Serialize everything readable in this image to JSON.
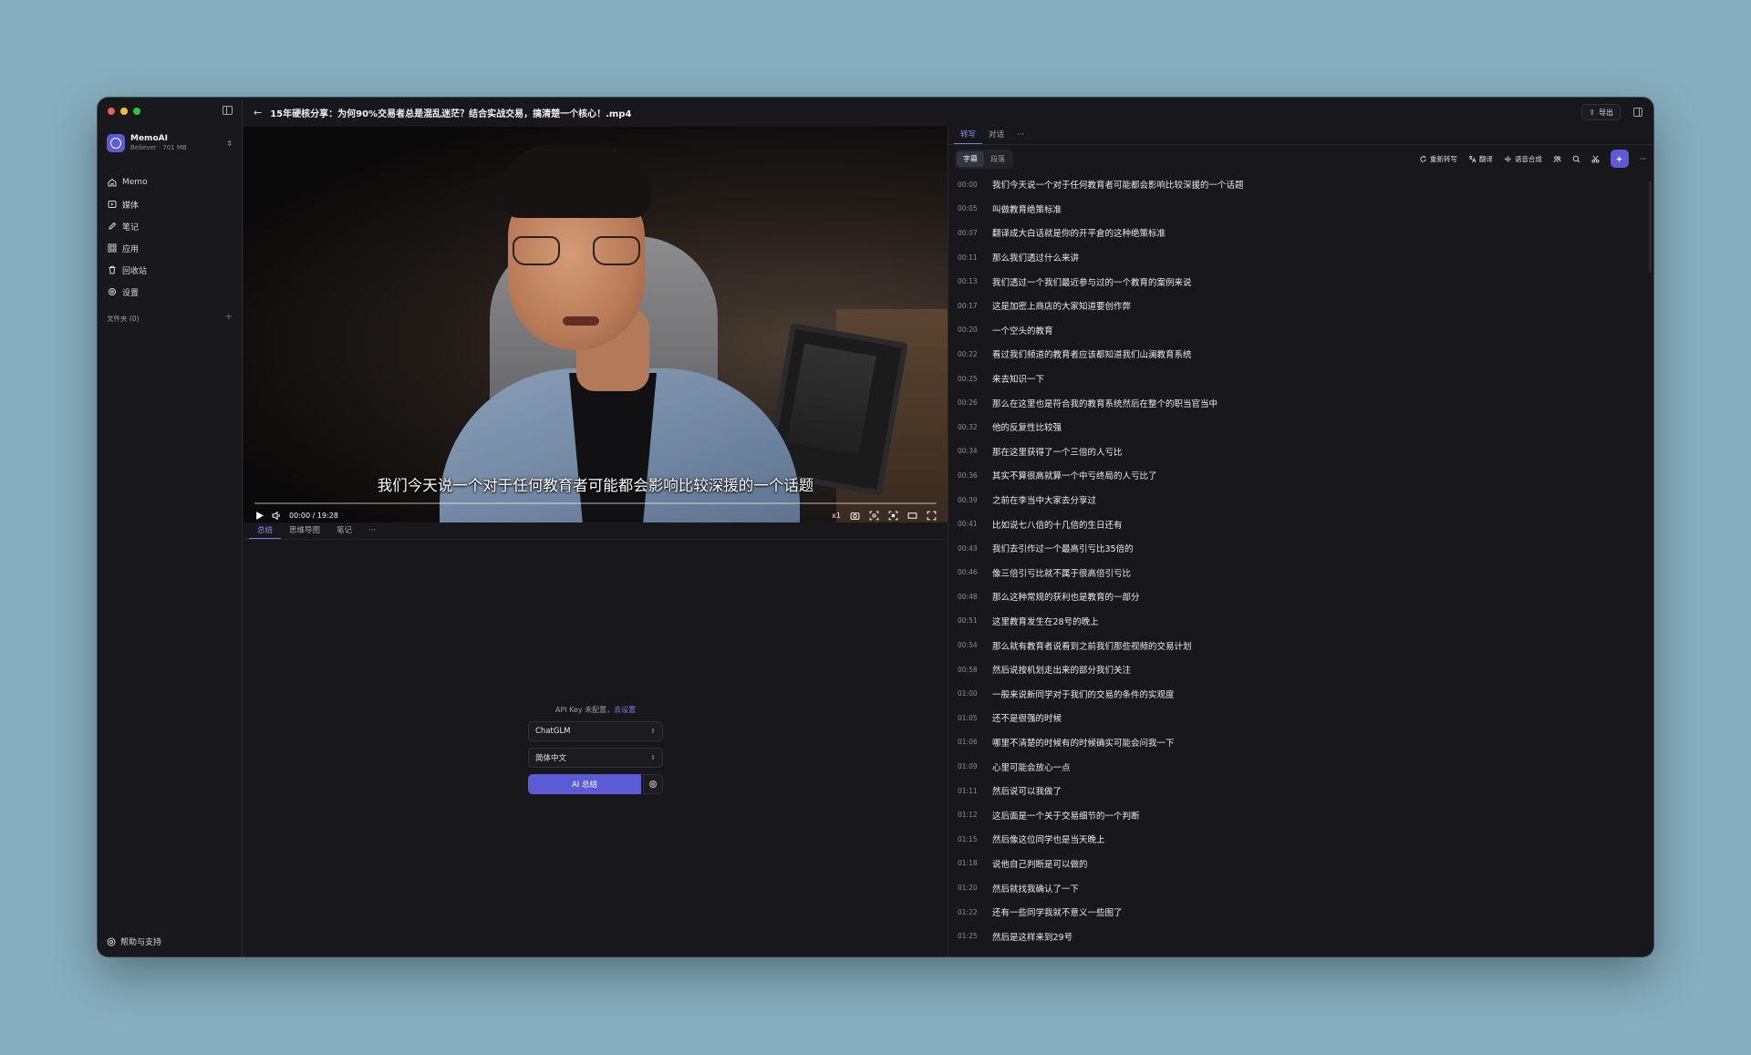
{
  "window": {
    "title": "15年硬核分享：为何90%交易者总是混乱迷茫？结合实战交易，搞清楚一个核心！.mp4",
    "export_label": "导出"
  },
  "sidebar": {
    "workspace_name": "MemoAI",
    "workspace_sub": "Believer · 701 MB",
    "items": [
      {
        "label": "Memo",
        "icon": "home-icon"
      },
      {
        "label": "媒体",
        "icon": "play-square-icon"
      },
      {
        "label": "笔记",
        "icon": "pencil-icon"
      },
      {
        "label": "应用",
        "icon": "grid-icon"
      },
      {
        "label": "回收站",
        "icon": "trash-icon"
      },
      {
        "label": "设置",
        "icon": "gear-icon"
      }
    ],
    "folders_label": "文件夹 (0)",
    "folders_add": "+",
    "help_label": "帮助与支持"
  },
  "video": {
    "subtitle": "我们今天说一个对于任何教育者可能都会影响比较深援的一个话题",
    "time": "00:00 / 19:28",
    "speed": "x1",
    "progress": 0
  },
  "left_tabs": [
    "总结",
    "思维导图",
    "笔记",
    "···"
  ],
  "ai": {
    "api_note": "API Key 未配置，",
    "api_link": "去设置",
    "model": "ChatGLM",
    "language": "简体中文",
    "button": "AI 总结"
  },
  "right_tabs": [
    "转写",
    "对话",
    "···"
  ],
  "segments": [
    "字幕",
    "段落"
  ],
  "tools": {
    "retranscribe": "重新转写",
    "translate": "翻译",
    "tts": "语音合成"
  },
  "transcript": [
    {
      "t": "00:00",
      "text": "我们今天说一个对于任何教育者可能都会影响比较深援的一个话题"
    },
    {
      "t": "00:05",
      "text": "叫做教育绝策标准"
    },
    {
      "t": "00:07",
      "text": "翻译成大白话就是你的开平倉的这种绝策标准"
    },
    {
      "t": "00:11",
      "text": "那么我们透过什么来讲"
    },
    {
      "t": "00:13",
      "text": "我们透过一个我们最近参与过的一个教育的案例来说"
    },
    {
      "t": "00:17",
      "text": "这是加密上商店的大家知道要创作弊"
    },
    {
      "t": "00:20",
      "text": "一个空头的教育"
    },
    {
      "t": "00:22",
      "text": "看过我们频道的教育者应该都知道我们山澜教育系统"
    },
    {
      "t": "00:25",
      "text": "来去知识一下"
    },
    {
      "t": "00:26",
      "text": "那么在这里也是符合我的教育系统然后在整个的职当官当中"
    },
    {
      "t": "00:32",
      "text": "他的反复性比较强"
    },
    {
      "t": "00:34",
      "text": "那在这里获得了一个三倍的人亏比"
    },
    {
      "t": "00:36",
      "text": "其实不算很高就算一个中亏终局的人亏比了"
    },
    {
      "t": "00:39",
      "text": "之前在李当中大家去分享过"
    },
    {
      "t": "00:41",
      "text": "比如说七八倍的十几倍的生日还有"
    },
    {
      "t": "00:43",
      "text": "我们去引作过一个最高引亏比35倍的"
    },
    {
      "t": "00:46",
      "text": "像三倍引亏比就不属于很高倍引亏比"
    },
    {
      "t": "00:48",
      "text": "那么这种常规的获利也是教育的一部分"
    },
    {
      "t": "00:51",
      "text": "这里教育发生在28号的晚上"
    },
    {
      "t": "00:54",
      "text": "那么就有教育者说看到之前我们那些视频的交易计划"
    },
    {
      "t": "00:58",
      "text": "然后说按机划走出来的部分我们关注"
    },
    {
      "t": "01:00",
      "text": "一般来说新同学对于我们的交易的条件的实观度"
    },
    {
      "t": "01:05",
      "text": "还不是很强的时候"
    },
    {
      "t": "01:06",
      "text": "哪里不清楚的时候有的时候确实可能会问我一下"
    },
    {
      "t": "01:09",
      "text": "心里可能会放心一点"
    },
    {
      "t": "01:11",
      "text": "然后说可以我做了"
    },
    {
      "t": "01:12",
      "text": "这后面是一个关于交易细节的一个判断"
    },
    {
      "t": "01:15",
      "text": "然后像这位同学也是当天晚上"
    },
    {
      "t": "01:18",
      "text": "说他自己判断是可以做的"
    },
    {
      "t": "01:20",
      "text": "然后就找我确认了一下"
    },
    {
      "t": "01:22",
      "text": "还有一些同学我就不意义一些图了"
    },
    {
      "t": "01:25",
      "text": "然后是这样来到29号"
    }
  ]
}
